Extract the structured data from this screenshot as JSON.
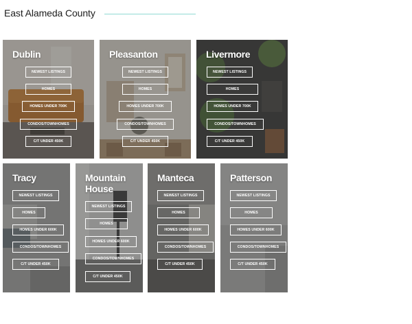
{
  "page": {
    "heading": "East Alameda County"
  },
  "cards": [
    {
      "city": "Dublin",
      "links": [
        "NEWEST LISTINGS",
        "HOMES",
        "HOMES UNDER 700K",
        "CONDOS/TOWNHOMES",
        "C/T UNDER 450K"
      ]
    },
    {
      "city": "Pleasanton",
      "links": [
        "NEWEST LISTINGS",
        "HOMES",
        "HOMES UNDER 700K",
        "CONDOS/TOWNHOMES",
        "C/T UNDER 450K"
      ]
    },
    {
      "city": "Livermore",
      "links": [
        "NEWEST LISTINGS",
        "HOMES",
        "HOMES UNDER 700K",
        "CONDOS/TOWNHOMES",
        "C/T UNDER 450K"
      ]
    },
    {
      "city": "Tracy",
      "links": [
        "NEWEST LISTINGS",
        "HOMES",
        "HOMES UNDER 600K",
        "CONDOS/TOWNHOMES",
        "C/T UNDER 450K"
      ]
    },
    {
      "city": "Mountain\nHouse",
      "links": [
        "NEWEST LISTINGS",
        "HOMES",
        "HOMES UNDER 600K",
        "CONDOS/TOWNHOMES",
        "C/T UNDER 450K"
      ]
    },
    {
      "city": "Manteca",
      "links": [
        "NEWEST LISTINGS",
        "HOMES",
        "HOMES UNDER 600K",
        "CONDOS/TOWNHOMES",
        "C/T UNDER 450K"
      ]
    },
    {
      "city": "Patterson",
      "links": [
        "NEWEST LISTINGS",
        "HOMES",
        "HOMES UNDER 600K",
        "CONDOS/TOWNHOMES",
        "C/T UNDER 450K"
      ]
    }
  ]
}
